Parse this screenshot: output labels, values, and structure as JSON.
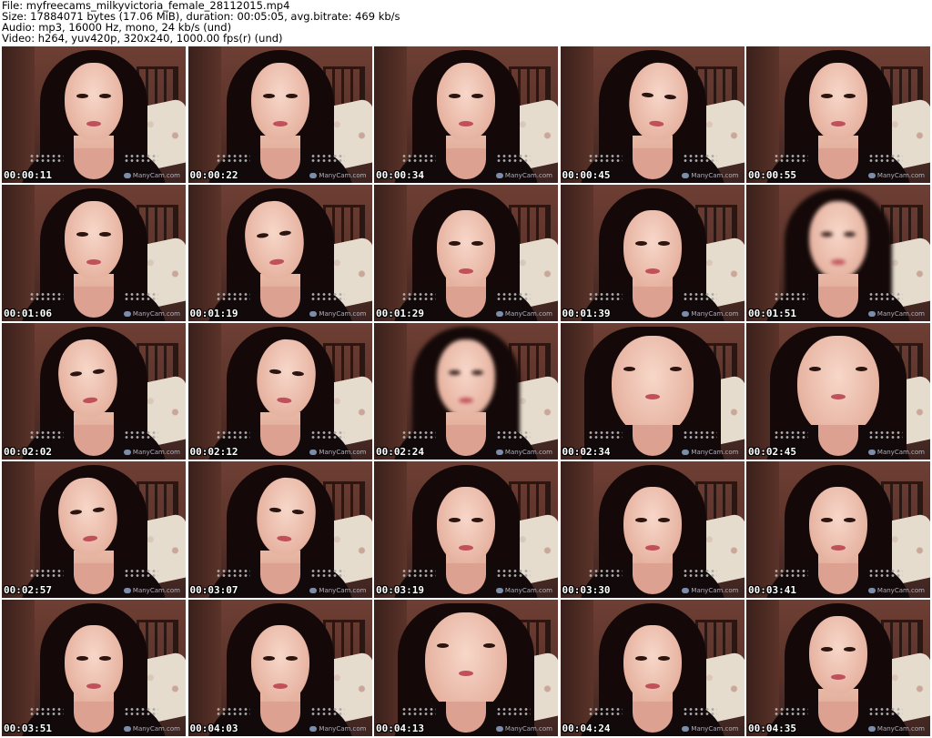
{
  "header": {
    "file": "File: myfreecams_milkyvictoria_female_28112015.mp4",
    "size": "Size: 17884071 bytes (17.06 MiB), duration: 00:05:05, avg.bitrate: 469 kb/s",
    "audio": "Audio: mp3, 16000 Hz, mono, 24 kb/s (und)",
    "video": "Video: h264, yuv420p, 320x240, 1000.00 fps(r) (und)"
  },
  "watermark": "ManyCam.com",
  "thumbnails": [
    {
      "timestamp": "00:00:11",
      "variant": ""
    },
    {
      "timestamp": "00:00:22",
      "variant": ""
    },
    {
      "timestamp": "00:00:34",
      "variant": ""
    },
    {
      "timestamp": "00:00:45",
      "variant": "variant-2"
    },
    {
      "timestamp": "00:00:55",
      "variant": ""
    },
    {
      "timestamp": "00:01:06",
      "variant": ""
    },
    {
      "timestamp": "00:01:19",
      "variant": "variant-1"
    },
    {
      "timestamp": "00:01:29",
      "variant": "variant-3"
    },
    {
      "timestamp": "00:01:39",
      "variant": "variant-3"
    },
    {
      "timestamp": "00:01:51",
      "variant": "variant-blur"
    },
    {
      "timestamp": "00:02:02",
      "variant": "variant-1"
    },
    {
      "timestamp": "00:02:12",
      "variant": "variant-2"
    },
    {
      "timestamp": "00:02:24",
      "variant": "variant-blur"
    },
    {
      "timestamp": "00:02:34",
      "variant": "variant-close"
    },
    {
      "timestamp": "00:02:45",
      "variant": "variant-close"
    },
    {
      "timestamp": "00:02:57",
      "variant": "variant-1"
    },
    {
      "timestamp": "00:03:07",
      "variant": "variant-2"
    },
    {
      "timestamp": "00:03:19",
      "variant": "variant-3"
    },
    {
      "timestamp": "00:03:30",
      "variant": "variant-3"
    },
    {
      "timestamp": "00:03:41",
      "variant": "variant-3"
    },
    {
      "timestamp": "00:03:51",
      "variant": "variant-3"
    },
    {
      "timestamp": "00:04:03",
      "variant": "variant-3"
    },
    {
      "timestamp": "00:04:13",
      "variant": "variant-close"
    },
    {
      "timestamp": "00:04:24",
      "variant": "variant-3"
    },
    {
      "timestamp": "00:04:35",
      "variant": ""
    }
  ]
}
